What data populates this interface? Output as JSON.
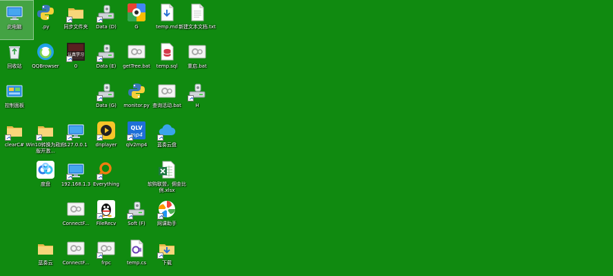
{
  "desktop": {
    "background_color": "#108a10",
    "icons": [
      {
        "id": "this-pc",
        "label": "此电脑",
        "icon": "computer-icon",
        "selected": true
      },
      {
        "id": "py",
        "label": ".py",
        "icon": "python-icon"
      },
      {
        "id": "sync-folder",
        "label": "同步文件夹",
        "icon": "folder-icon",
        "shortcut": true
      },
      {
        "id": "data-d",
        "label": "Data (D)",
        "icon": "drive-icon",
        "shortcut": true
      },
      {
        "id": "g",
        "label": "G",
        "icon": "google-icon"
      },
      {
        "id": "temp-md",
        "label": "temp.md",
        "icon": "markdown-file-icon"
      },
      {
        "id": "new-text",
        "label": "新建文本文档.txt",
        "icon": "text-file-icon"
      },
      {
        "id": "recycle-bin",
        "label": "回收站",
        "icon": "recycle-bin-icon"
      },
      {
        "id": "qqbrowser",
        "label": "QQBrowser",
        "icon": "qqbrowser-icon"
      },
      {
        "id": "study",
        "label": "0",
        "icon": "study-image-icon",
        "image_text": "认真学习",
        "shortcut": true
      },
      {
        "id": "data-e",
        "label": "Data (E)",
        "icon": "drive-icon",
        "shortcut": true
      },
      {
        "id": "gettree",
        "label": "getTree.bat",
        "icon": "bat-file-icon"
      },
      {
        "id": "temp-sql",
        "label": "temp.sql",
        "icon": "sql-file-icon"
      },
      {
        "id": "restart-bat",
        "label": "重启.bat",
        "icon": "bat-file-icon"
      },
      {
        "id": "control-panel",
        "label": "控制面板",
        "icon": "control-panel-icon"
      },
      {
        "id": "data-g",
        "label": "Data (G)",
        "icon": "drive-icon",
        "shortcut": true
      },
      {
        "id": "monitor-py",
        "label": "monitor.py",
        "icon": "python-icon"
      },
      {
        "id": "query-activity",
        "label": "查询活动.bat",
        "icon": "bat-file-icon"
      },
      {
        "id": "h",
        "label": "H",
        "icon": "drive-icon",
        "shortcut": true
      },
      {
        "id": "clearc",
        "label": "clearC#",
        "icon": "folder-icon",
        "shortcut": true
      },
      {
        "id": "win10",
        "label": "Win10转换为政府版开激...",
        "icon": "folder-icon",
        "shortcut": true
      },
      {
        "id": "ip127",
        "label": "127.0.0.1",
        "icon": "computer-icon",
        "shortcut": true
      },
      {
        "id": "dnplayer",
        "label": "dnplayer",
        "icon": "dnplayer-icon",
        "shortcut": true
      },
      {
        "id": "qlv2mp4",
        "label": "qlv2mp4",
        "icon": "qlv-icon",
        "image_text": "QLV mp4",
        "shortcut": true
      },
      {
        "id": "lanzou1",
        "label": "蓝奏云盘",
        "icon": "cloud-icon",
        "shortcut": true
      },
      {
        "id": "baidu-pan",
        "label": "度盘",
        "icon": "baidu-pan-icon"
      },
      {
        "id": "ip192",
        "label": "192.168.1.3",
        "icon": "computer-icon",
        "shortcut": true
      },
      {
        "id": "everything",
        "label": "Everything",
        "icon": "everything-icon",
        "shortcut": true
      },
      {
        "id": "xlsx",
        "label": "软购联盟，佣金比例.xlsx",
        "icon": "excel-file-icon"
      },
      {
        "id": "connect1",
        "label": "ConnectF...",
        "icon": "bat-file-icon"
      },
      {
        "id": "filerecv",
        "label": "FileRecv",
        "icon": "qq-icon",
        "shortcut": true
      },
      {
        "id": "soft-f",
        "label": "Soft (F)",
        "icon": "drive-icon",
        "shortcut": true
      },
      {
        "id": "netclass",
        "label": "网课助手",
        "icon": "pinwheel-icon",
        "shortcut": true
      },
      {
        "id": "lanzou2",
        "label": "蓝奏云",
        "icon": "folder-icon"
      },
      {
        "id": "connect2",
        "label": "ConnectF...",
        "icon": "bat-file-icon"
      },
      {
        "id": "frpc",
        "label": "frpc",
        "icon": "bat-file-icon",
        "shortcut": true
      },
      {
        "id": "temp-cs",
        "label": "temp.cs",
        "icon": "csharp-file-icon"
      },
      {
        "id": "download",
        "label": "下载",
        "icon": "download-folder-icon",
        "shortcut": true
      }
    ]
  }
}
